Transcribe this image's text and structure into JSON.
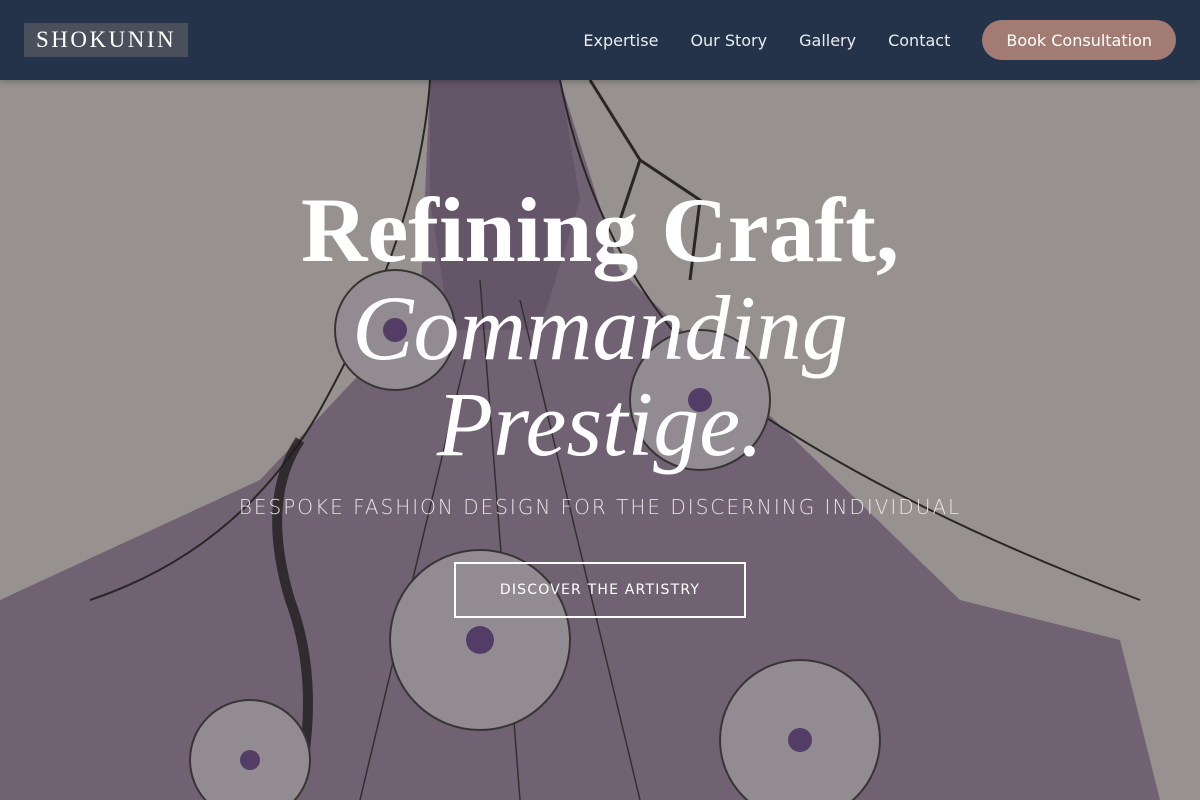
{
  "header": {
    "brand": "SHOKUNIN",
    "nav": [
      "Expertise",
      "Our Story",
      "Gallery",
      "Contact"
    ],
    "cta_label": "Book Consultation"
  },
  "hero": {
    "headline_line1": "Refining Craft,",
    "headline_line2": "Commanding",
    "headline_line3": "Prestige.",
    "subtitle": "BESPOKE FASHION DESIGN FOR THE DISCERNING INDIVIDUAL",
    "button_label": "DISCOVER THE ARTISTRY",
    "background": "fashion-sketch-illustration"
  },
  "colors": {
    "header_bg": "#24334a",
    "cta_bg": "#a27b73",
    "gown": "#8a7295",
    "flower_center": "#5d3a86"
  }
}
